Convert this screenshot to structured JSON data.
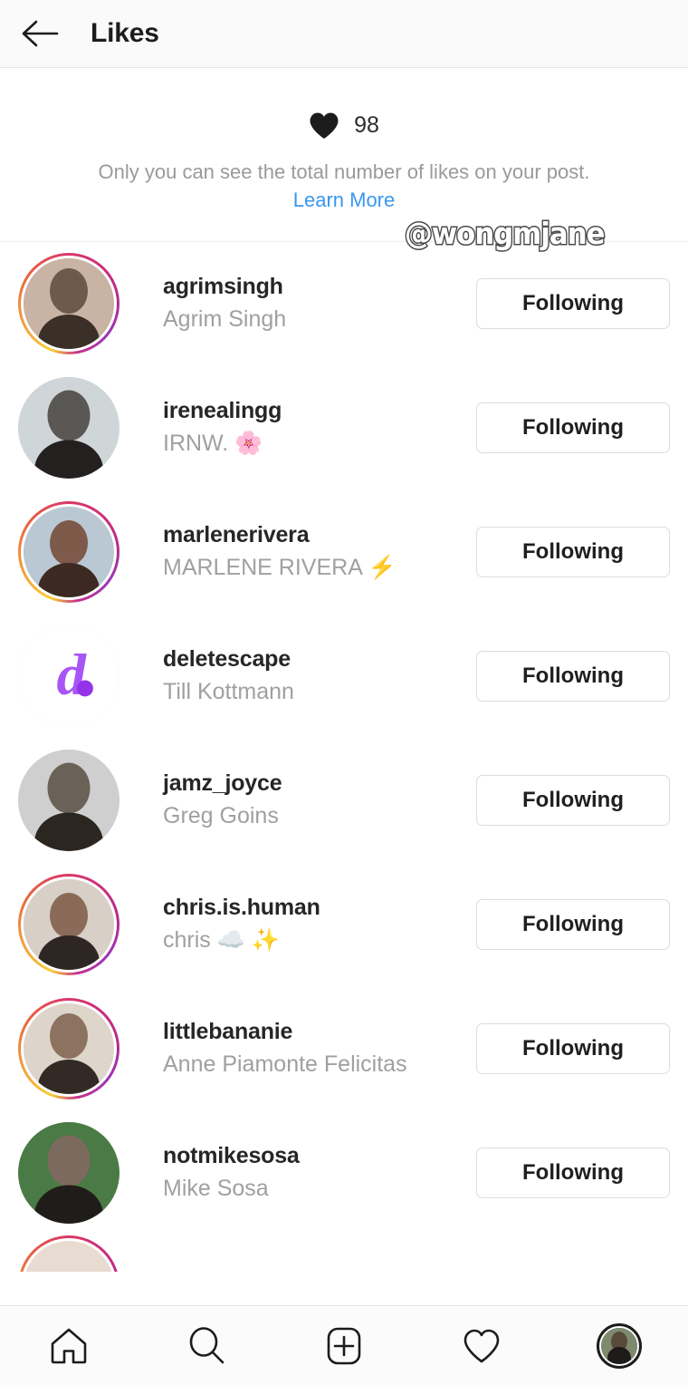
{
  "header": {
    "title": "Likes",
    "back_icon": "arrow-left-icon"
  },
  "likes_info": {
    "heart_icon": "heart-filled-icon",
    "count": "98",
    "note": "Only you can see the total number of likes on your post.",
    "learn_more": "Learn More",
    "learn_more_color": "#3897f0"
  },
  "watermark": {
    "text": "@wongmjane"
  },
  "users": [
    {
      "username": "agrimsingh",
      "fullname": "Agrim Singh",
      "button": "Following",
      "has_story_ring": true,
      "avatar_type": "photo",
      "avatar_colors": [
        "#c9b3a4",
        "#6d5a4d",
        "#3a3028"
      ]
    },
    {
      "username": "irenealingg",
      "fullname": "IRNW. 🌸",
      "button": "Following",
      "has_story_ring": false,
      "avatar_type": "photo",
      "avatar_colors": [
        "#cfd6d8",
        "#5a5754",
        "#23201f"
      ]
    },
    {
      "username": "marlenerivera",
      "fullname": "MARLENE RIVERA ⚡",
      "button": "Following",
      "has_story_ring": true,
      "avatar_type": "photo",
      "avatar_colors": [
        "#b9c8d2",
        "#7d5a4b",
        "#3c2a22"
      ]
    },
    {
      "username": "deletescape",
      "fullname": "Till Kottmann",
      "button": "Following",
      "has_story_ring": false,
      "avatar_type": "logo",
      "avatar_colors": [
        "#ffffff",
        "#a855f7",
        "#9333ea"
      ]
    },
    {
      "username": "jamz_joyce",
      "fullname": "Greg Goins",
      "button": "Following",
      "has_story_ring": false,
      "avatar_type": "photo",
      "avatar_colors": [
        "#cfcfcf",
        "#6b6257",
        "#2c2620"
      ]
    },
    {
      "username": "chris.is.human",
      "fullname": "chris ☁️ ✨",
      "button": "Following",
      "has_story_ring": true,
      "avatar_type": "photo",
      "avatar_colors": [
        "#d8cfc6",
        "#8a6a58",
        "#2e2622"
      ]
    },
    {
      "username": "littlebananie",
      "fullname": "Anne Piamonte Felicitas",
      "button": "Following",
      "has_story_ring": true,
      "avatar_type": "photo",
      "avatar_colors": [
        "#ded6cb",
        "#8d7260",
        "#332a25"
      ]
    },
    {
      "username": "notmikesosa",
      "fullname": "Mike Sosa",
      "button": "Following",
      "has_story_ring": false,
      "avatar_type": "photo",
      "avatar_colors": [
        "#4a7a45",
        "#7d6a5e",
        "#201c19"
      ]
    }
  ],
  "bottom_nav": [
    {
      "icon": "home-icon",
      "active": false
    },
    {
      "icon": "search-icon",
      "active": false
    },
    {
      "icon": "add-post-icon",
      "active": false
    },
    {
      "icon": "heart-outline-icon",
      "active": false
    },
    {
      "icon": "profile-avatar",
      "active": true
    }
  ]
}
